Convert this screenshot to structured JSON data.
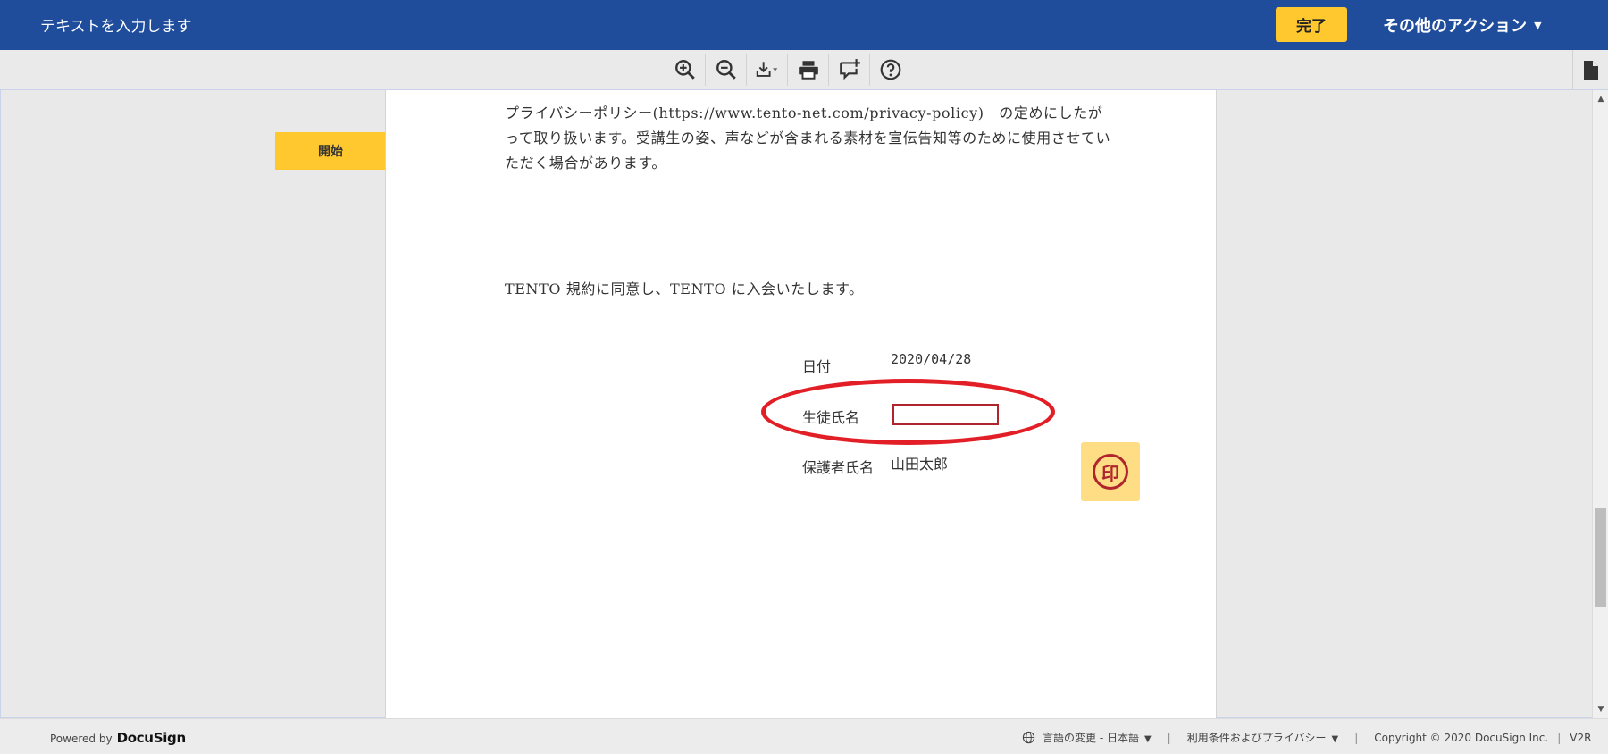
{
  "header": {
    "title": "テキストを入力します",
    "finish_label": "完了",
    "other_actions_label": "その他のアクション",
    "caret": "▼"
  },
  "toolbar": {
    "tools": [
      "zoom-in-icon",
      "zoom-out-icon",
      "download-icon",
      "print-icon",
      "add-comment-icon",
      "help-icon"
    ],
    "side_panel_icon": "document-icon"
  },
  "document": {
    "start_tag_label": "開始",
    "paragraph1": "プライバシーポリシー(https://www.tento-net.com/privacy-policy)　の定めにしたがって取り扱います。受講生の姿、声などが含まれる素材を宣伝告知等のために使用させていただく場合があります。",
    "paragraph2": "TENTO 規約に同意し、TENTO に入会いたします。",
    "date_label": "日付",
    "date_value": "2020/04/28",
    "student_label": "生徒氏名",
    "student_value": "",
    "guardian_label": "保護者氏名",
    "guardian_value": "山田太郎",
    "stamp_label": "印",
    "highlight_color": "#e21f26",
    "field_border_color": "#b0252d"
  },
  "footer": {
    "powered_by": "Powered by",
    "brand": "DocuSign",
    "language_label": "言語の変更 - 日本語",
    "terms_label": "利用条件およびプライバシー",
    "copyright": "Copyright © 2020 DocuSign Inc.",
    "version": "V2R",
    "dropdown_caret": "▼",
    "separator": "|"
  },
  "colors": {
    "header_bg": "#1f4d9c",
    "accent_yellow": "#fec82e"
  }
}
